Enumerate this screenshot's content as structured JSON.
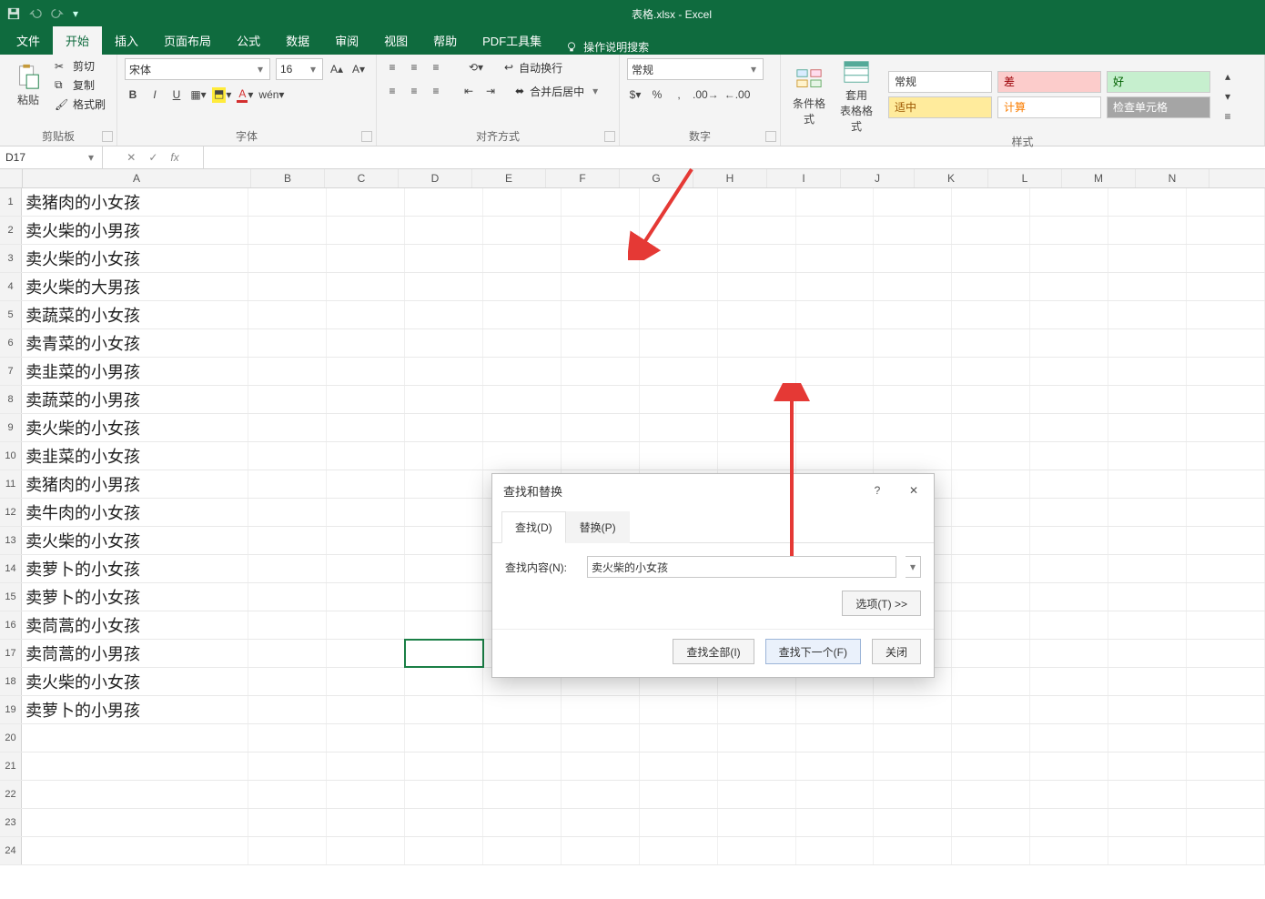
{
  "app": {
    "title": "表格.xlsx  -  Excel"
  },
  "qat": {
    "save": "保存",
    "undo": "撤销",
    "redo": "重做"
  },
  "tabs": {
    "file": "文件",
    "home": "开始",
    "insert": "插入",
    "layout": "页面布局",
    "formulas": "公式",
    "data": "数据",
    "review": "审阅",
    "view": "视图",
    "help": "帮助",
    "pdf": "PDF工具集",
    "tell": "操作说明搜索"
  },
  "ribbon": {
    "clipboard": {
      "paste": "粘贴",
      "cut": "剪切",
      "copy": "复制",
      "painter": "格式刷",
      "title": "剪贴板"
    },
    "font": {
      "name": "宋体",
      "size": "16",
      "bold": "B",
      "italic": "I",
      "underline": "U",
      "title": "字体"
    },
    "align": {
      "wrap": "自动换行",
      "merge": "合并后居中",
      "title": "对齐方式"
    },
    "number": {
      "format": "常规",
      "title": "数字"
    },
    "styles": {
      "cond": "条件格式",
      "table": "套用\n表格格式",
      "s1": "常规",
      "s2": "差",
      "s3": "好",
      "s4": "适中",
      "s5": "计算",
      "s6": "检查单元格",
      "title": "样式"
    }
  },
  "namebox": "D17",
  "columns": [
    "A",
    "B",
    "C",
    "D",
    "E",
    "F",
    "G",
    "H",
    "I",
    "J",
    "K",
    "L",
    "M",
    "N"
  ],
  "rows": [
    "卖猪肉的小女孩",
    "卖火柴的小男孩",
    "卖火柴的小女孩",
    "卖火柴的大男孩",
    "卖蔬菜的小女孩",
    "卖青菜的小女孩",
    "卖韭菜的小男孩",
    "卖蔬菜的小男孩",
    "卖火柴的小女孩",
    "卖韭菜的小女孩",
    "卖猪肉的小男孩",
    "卖牛肉的小女孩",
    "卖火柴的小女孩",
    "卖萝卜的小女孩",
    "卖萝卜的小女孩",
    "卖茼蒿的小女孩",
    "卖茼蒿的小男孩",
    "卖火柴的小女孩",
    "卖萝卜的小男孩",
    "",
    "",
    "",
    "",
    ""
  ],
  "selected": {
    "row": 17,
    "col": "D"
  },
  "dialog": {
    "title": "查找和替换",
    "tab_find": "查找(D)",
    "tab_replace": "替换(P)",
    "label_find": "查找内容(N):",
    "value_find": "卖火柴的小女孩",
    "options": "选项(T) >>",
    "find_all": "查找全部(I)",
    "find_next": "查找下一个(F)",
    "close": "关闭",
    "help": "?",
    "x": "✕"
  }
}
